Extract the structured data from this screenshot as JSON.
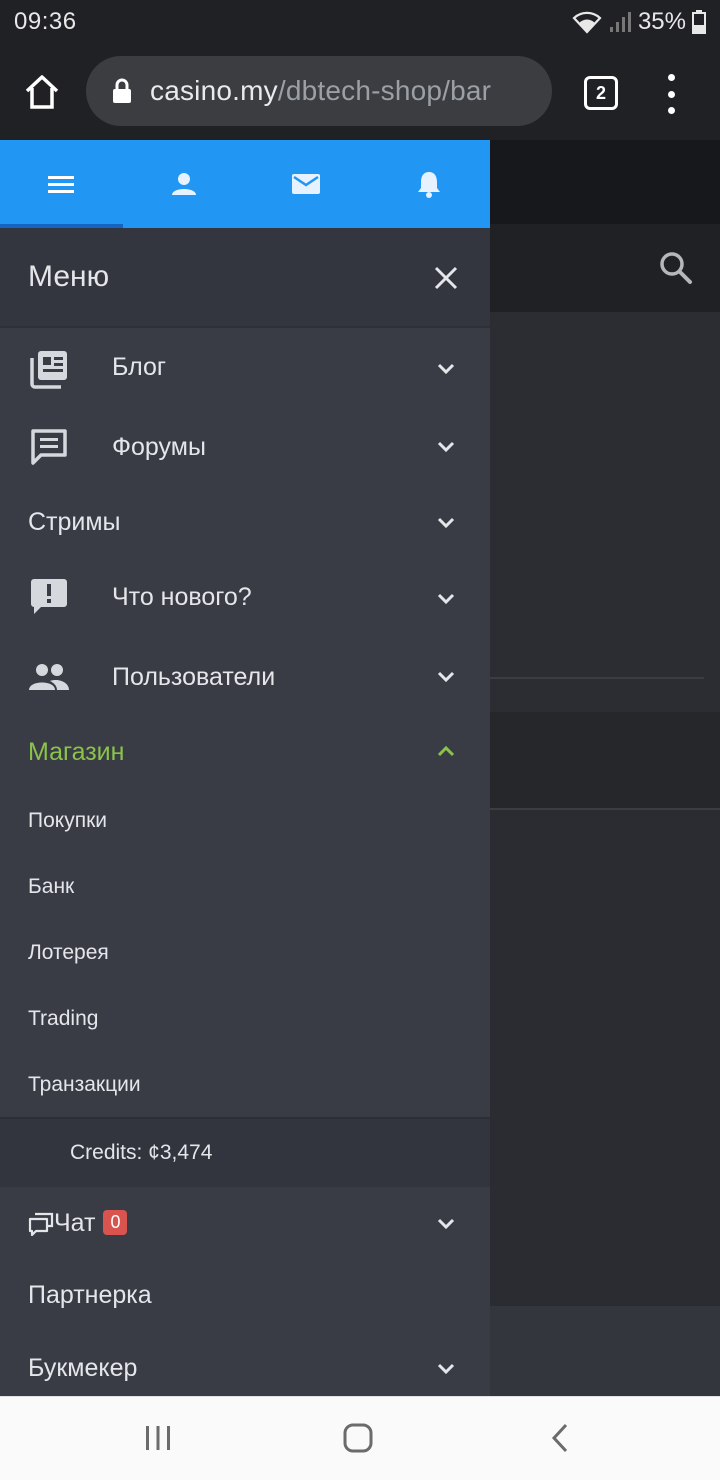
{
  "status_bar": {
    "time": "09:36",
    "battery": "35%"
  },
  "browser": {
    "url_host": "casino.my",
    "url_path": "/dbtech-shop/bar",
    "tab_count": "2"
  },
  "drawer": {
    "title": "Меню",
    "tabs": [
      {
        "icon": "menu-icon"
      },
      {
        "icon": "user-icon"
      },
      {
        "icon": "mail-icon"
      },
      {
        "icon": "bell-icon"
      }
    ],
    "items": {
      "blog": "Блог",
      "forums": "Форумы",
      "streams": "Стримы",
      "whats_new": "Что нового?",
      "members": "Пользователи",
      "shop": "Магазин",
      "chat": "Чат",
      "chat_count": "0",
      "partner": "Партнерка",
      "bookmaker": "Букмекер"
    },
    "shop_submenu": {
      "purchases": "Покупки",
      "bank": "Банк",
      "lottery": "Лотерея",
      "trading": "Trading",
      "transactions": "Транзакции"
    },
    "credits": "Credits: ¢3,474"
  },
  "colors": {
    "accent_blue": "#2196f3",
    "active_green": "#8bc34a",
    "badge_red": "#d9534f"
  }
}
